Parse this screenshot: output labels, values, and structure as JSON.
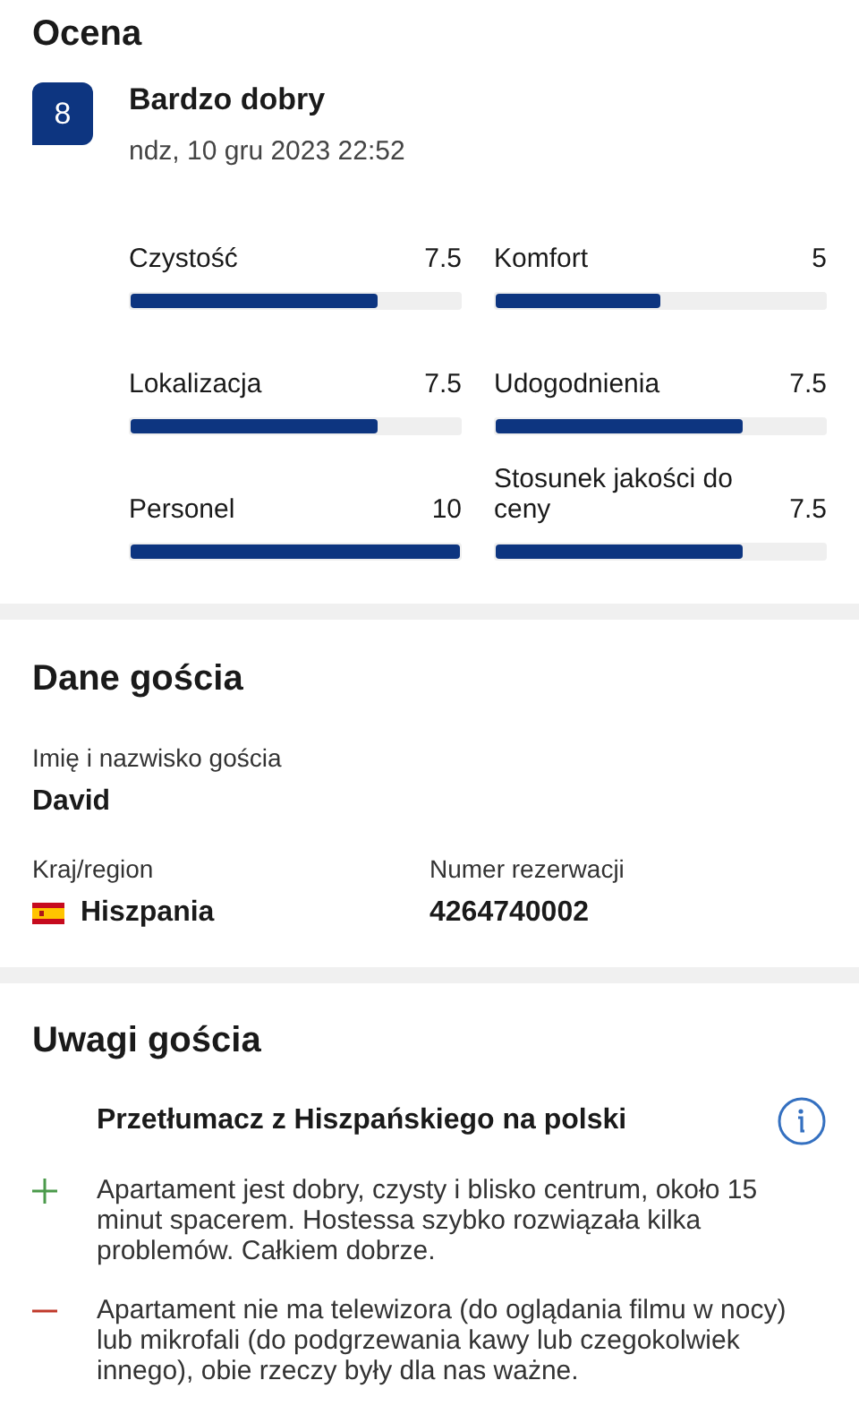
{
  "rating": {
    "title": "Ocena",
    "score": "8",
    "verdict": "Bardzo dobry",
    "date": "ndz, 10 gru 2023 22:52",
    "categories": [
      {
        "label": "Czystość",
        "value": "7.5",
        "level": 0.75
      },
      {
        "label": "Lokalizacja",
        "value": "7.5",
        "level": 0.75
      },
      {
        "label": "Personel",
        "value": "10",
        "level": 1
      },
      {
        "label": "Komfort",
        "value": "5",
        "level": 0.5
      },
      {
        "label": "Udogodnienia",
        "value": "7.5",
        "level": 0.75
      },
      {
        "label": "Stosunek jakości do ceny",
        "value": "7.5",
        "level": 0.75
      }
    ]
  },
  "guest": {
    "title": "Dane gościa",
    "name_label": "Imię i nazwisko gościa",
    "name": "David",
    "country_label": "Kraj/region",
    "country": "Hiszpania",
    "booking_label": "Numer rezerwacji",
    "booking_number": "4264740002"
  },
  "comments": {
    "title": "Uwagi gościa",
    "translation_note": "Przetłumacz z Hiszpańskiego na polski",
    "items": [
      {
        "kind": "positive",
        "text": "Apartament jest dobry, czysty i blisko centrum, około 15 minut spacerem. Hostessa szybko rozwiązała kilka problemów. Całkiem dobrze."
      },
      {
        "kind": "negative",
        "text": "Apartament nie ma telewizora (do oglądania filmu w nocy) lub mikrofali (do podgrzewania kawy lub czegokolwiek innego), obie rzeczy były dla nas ważne."
      }
    ]
  }
}
